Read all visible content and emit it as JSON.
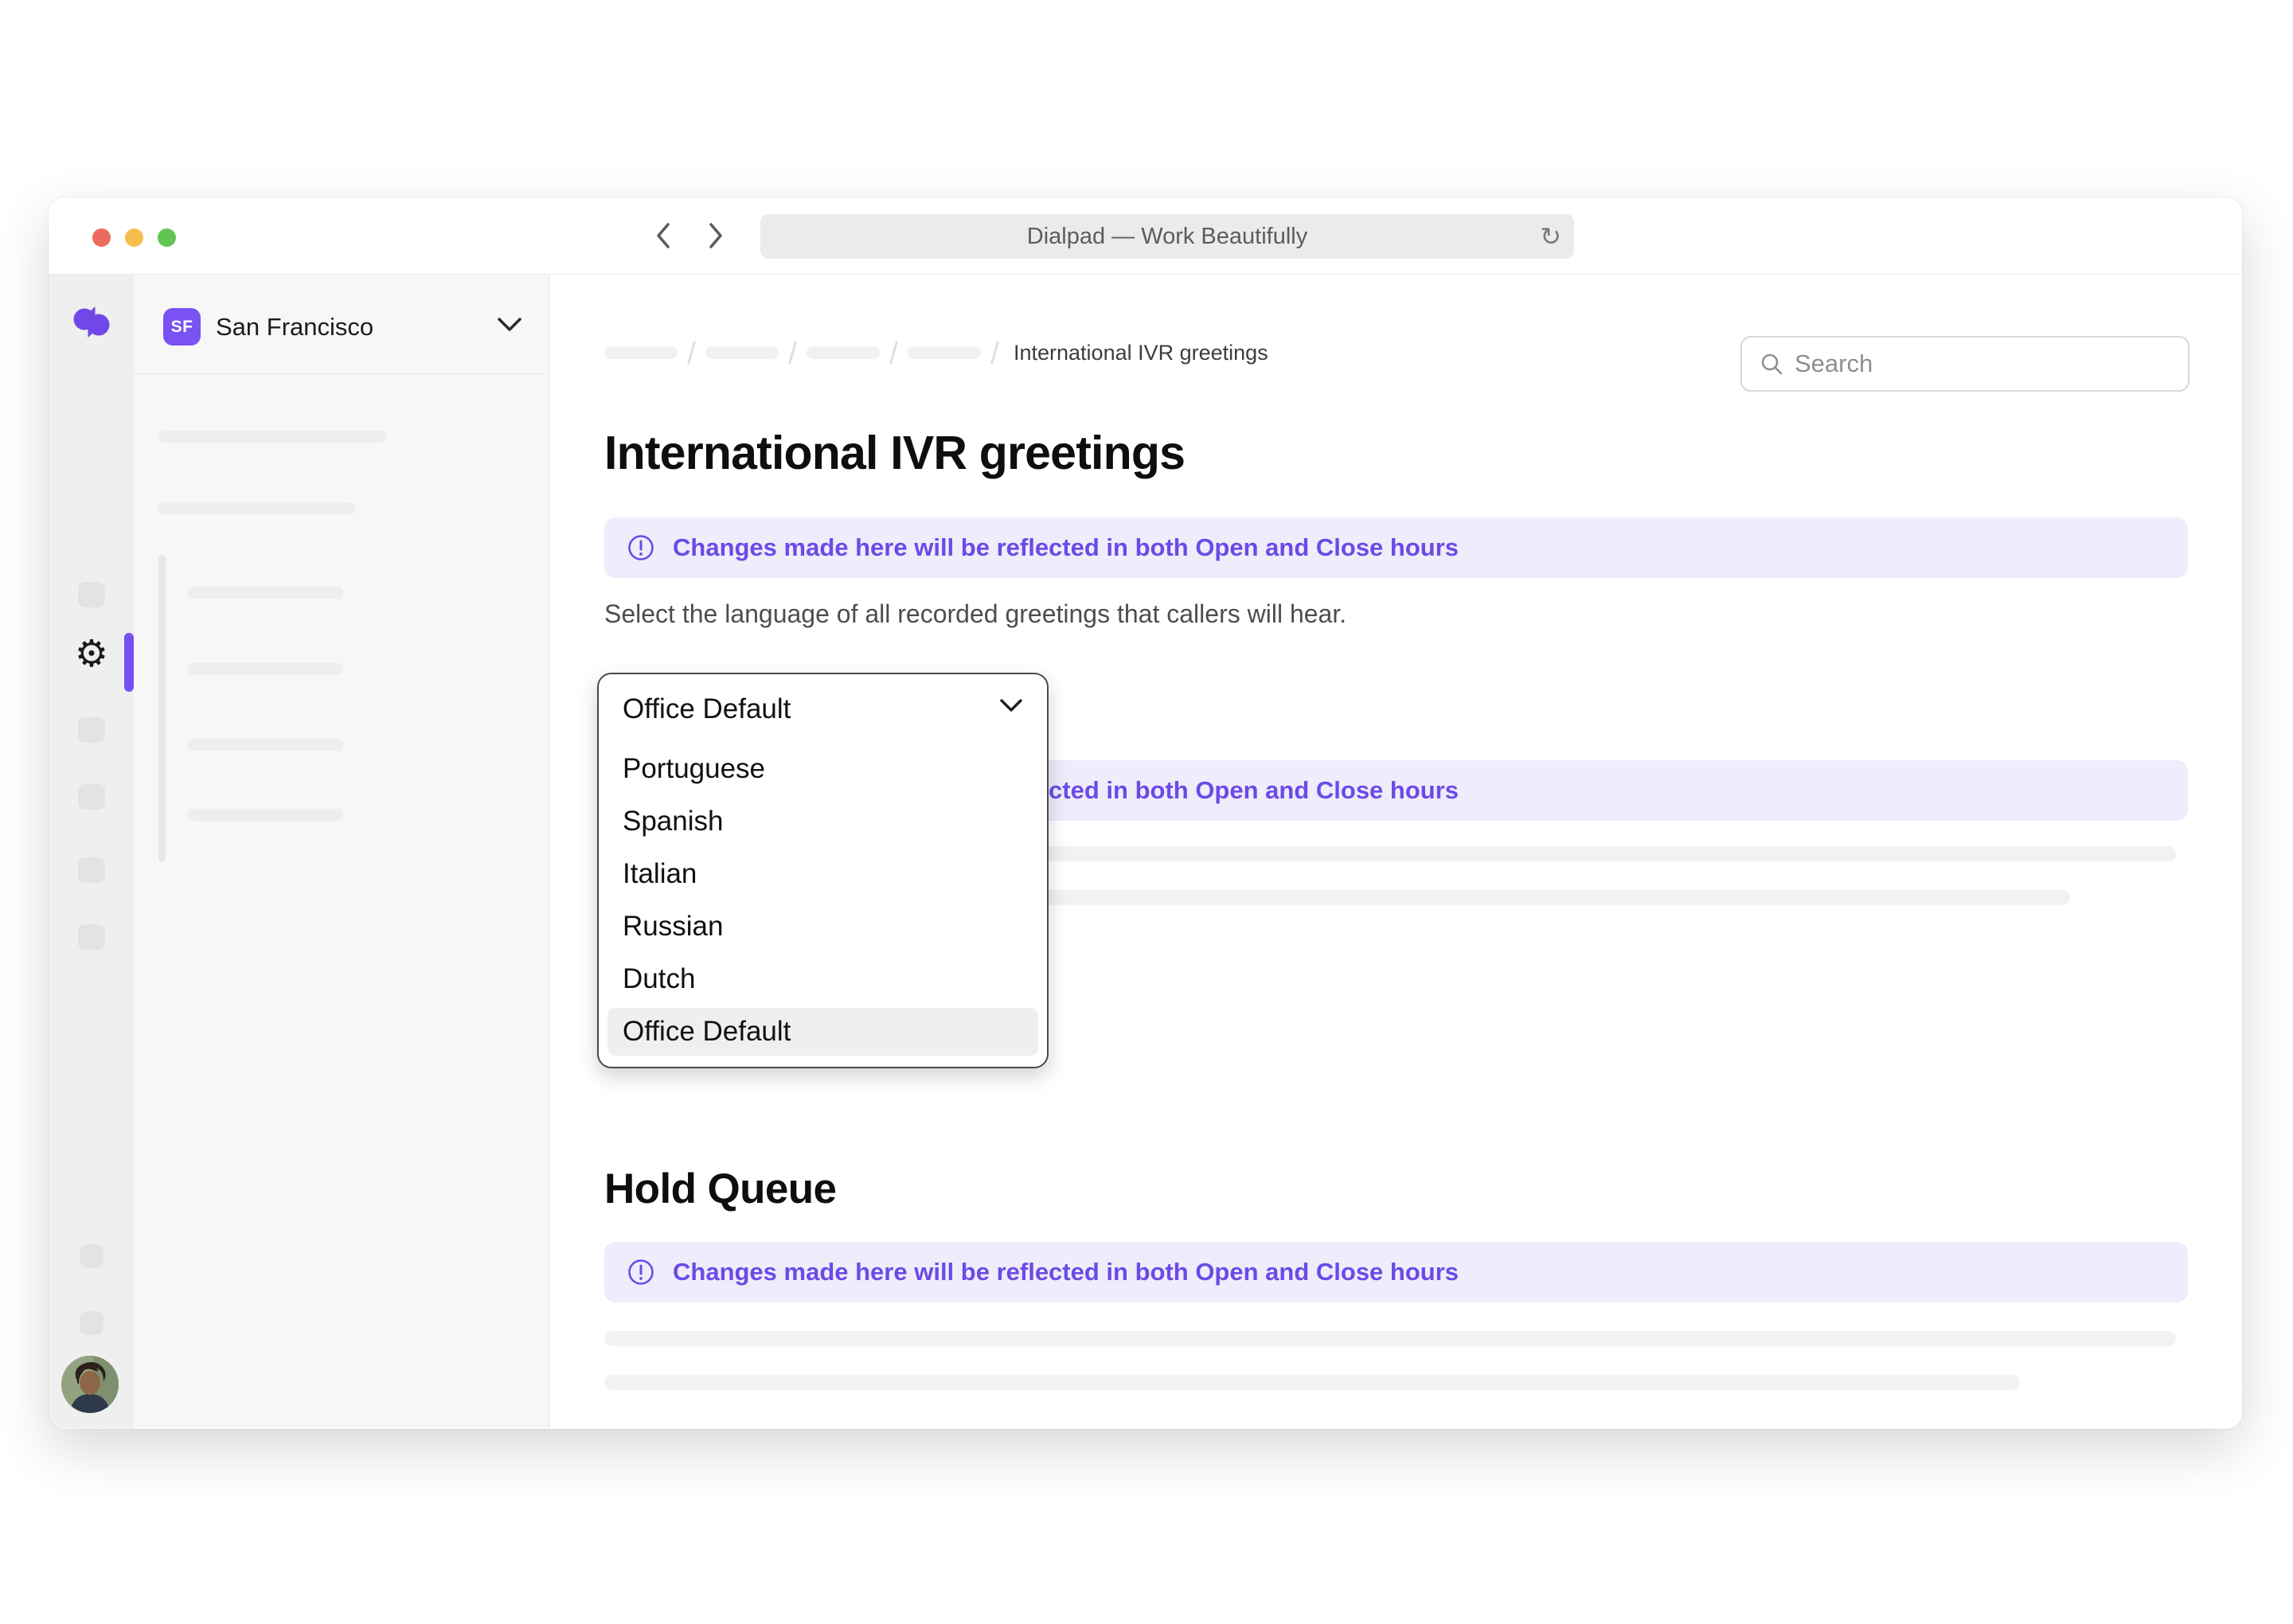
{
  "browser": {
    "title": "Dialpad — Work Beautifully"
  },
  "org": {
    "badge": "SF",
    "name": "San Francisco"
  },
  "breadcrumb": {
    "current": "International IVR greetings"
  },
  "search": {
    "placeholder": "Search"
  },
  "content": {
    "title": "International IVR greetings",
    "notice": "Changes made here will be reflected in both Open and Close hours",
    "description": "Select the language of all recorded greetings that callers will hear.",
    "dropdown": {
      "selected": "Office Default",
      "options": [
        "Portuguese",
        "Spanish",
        "Italian",
        "Russian",
        "Dutch",
        "Office Default"
      ],
      "highlighted": "Office Default"
    },
    "hold_queue_title": "Hold Queue"
  },
  "icons": {
    "gear": "⚙",
    "reload": "↻"
  },
  "colors": {
    "brand_purple": "#7048e8",
    "badge_purple": "#7a52f4",
    "active_indicator": "#7450f0",
    "notice_text": "#6a4be6",
    "notice_bg": "#efecfb",
    "traffic_red": "#ec6a5e",
    "traffic_yellow": "#f5bf4f",
    "traffic_green": "#61c554"
  }
}
